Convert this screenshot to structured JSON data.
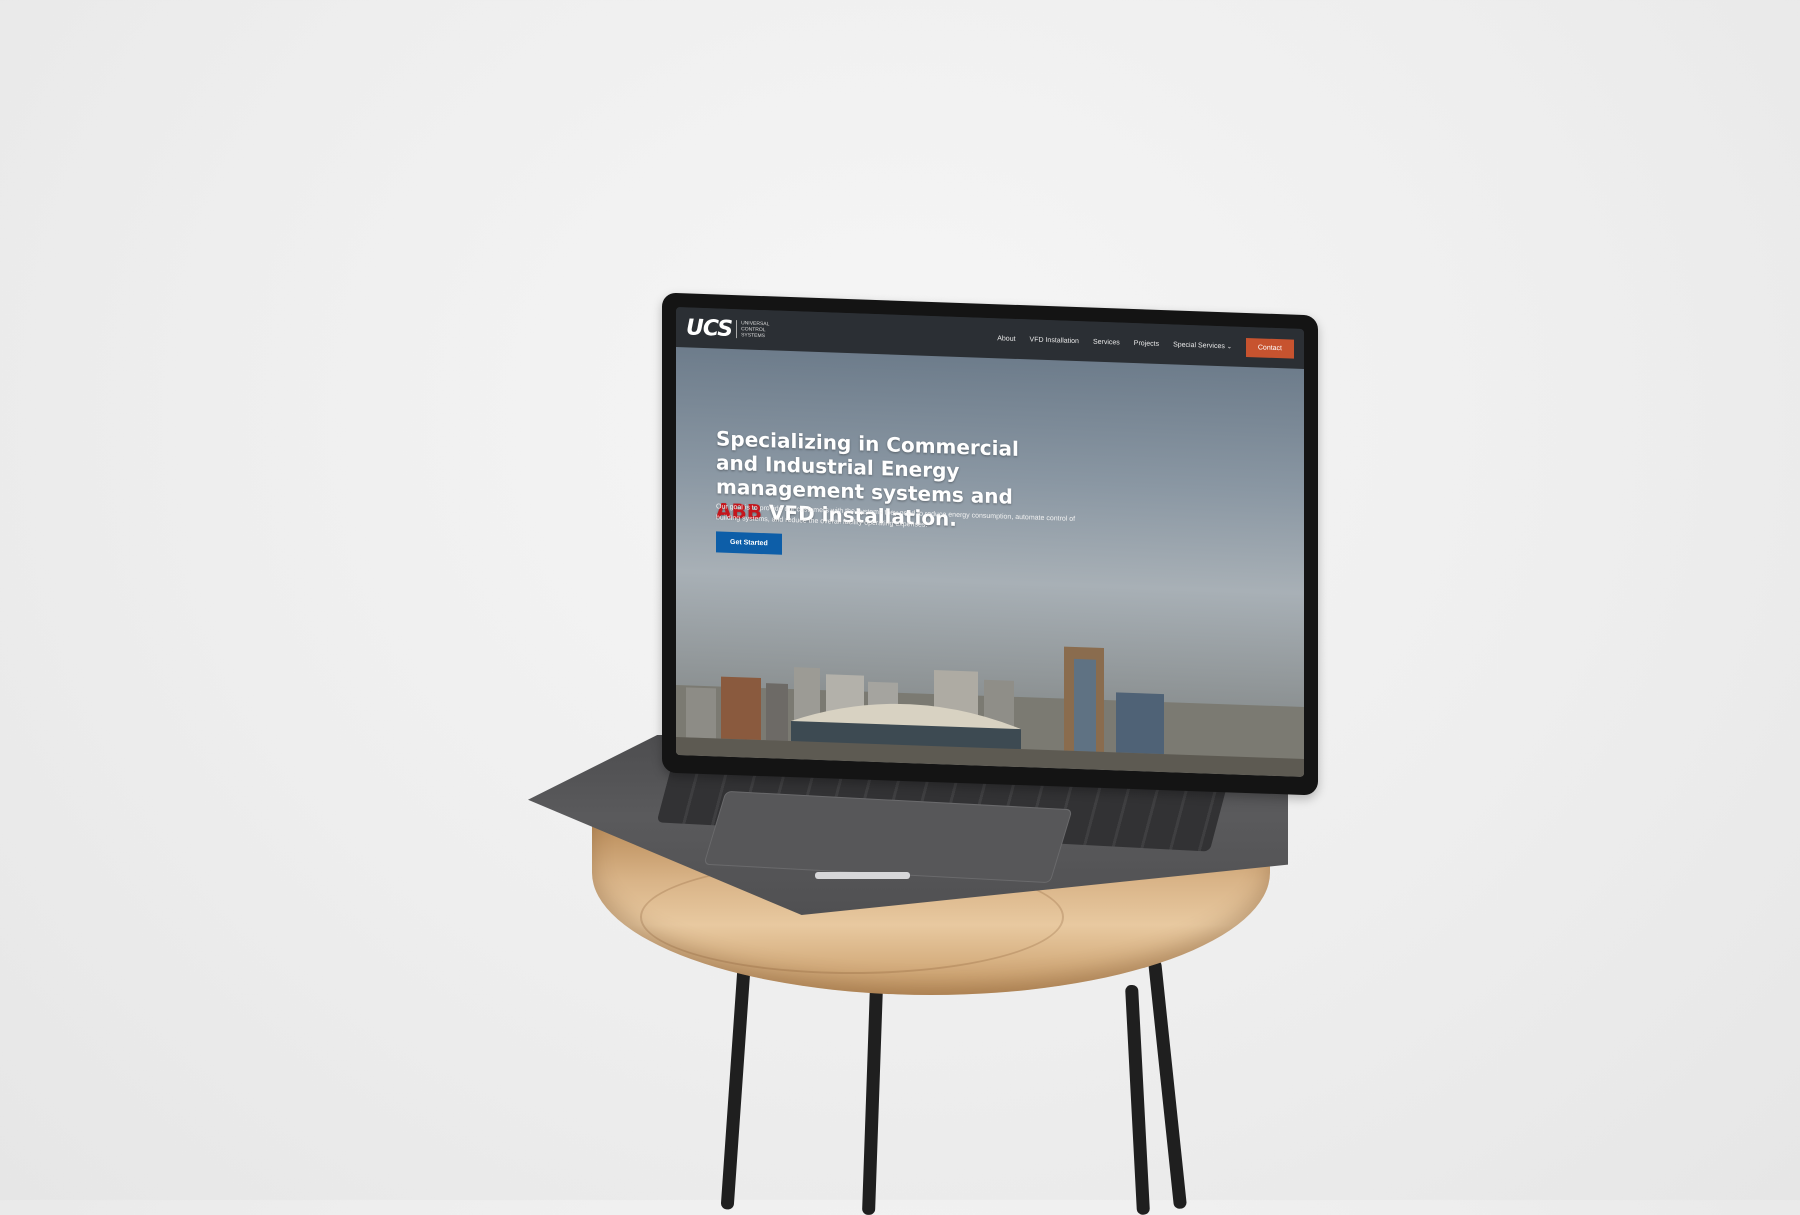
{
  "site": {
    "logo": {
      "mark": "UCS",
      "text": "UNIVERSAL CONTROL SYSTEMS"
    },
    "nav": [
      {
        "label": "About"
      },
      {
        "label": "VFD Installation"
      },
      {
        "label": "Services"
      },
      {
        "label": "Projects"
      },
      {
        "label": "Special Services"
      }
    ],
    "contact_label": "Contact",
    "hero": {
      "title_part1": "Specializing in Commercial and Industrial Energy management systems and ",
      "title_highlight": "ABB",
      "title_part2": " VFD installation.",
      "subtitle": "Our goal is to provide our customers with the systems they need to reduce energy consumption, automate control of building systems, and reduce the overall facility operating expenses.",
      "cta_label": "Get Started"
    },
    "colors": {
      "header_bg": "#2b2f34",
      "contact_bg": "#c7532f",
      "cta_bg": "#0d5ea8",
      "highlight": "#c4161c"
    }
  }
}
